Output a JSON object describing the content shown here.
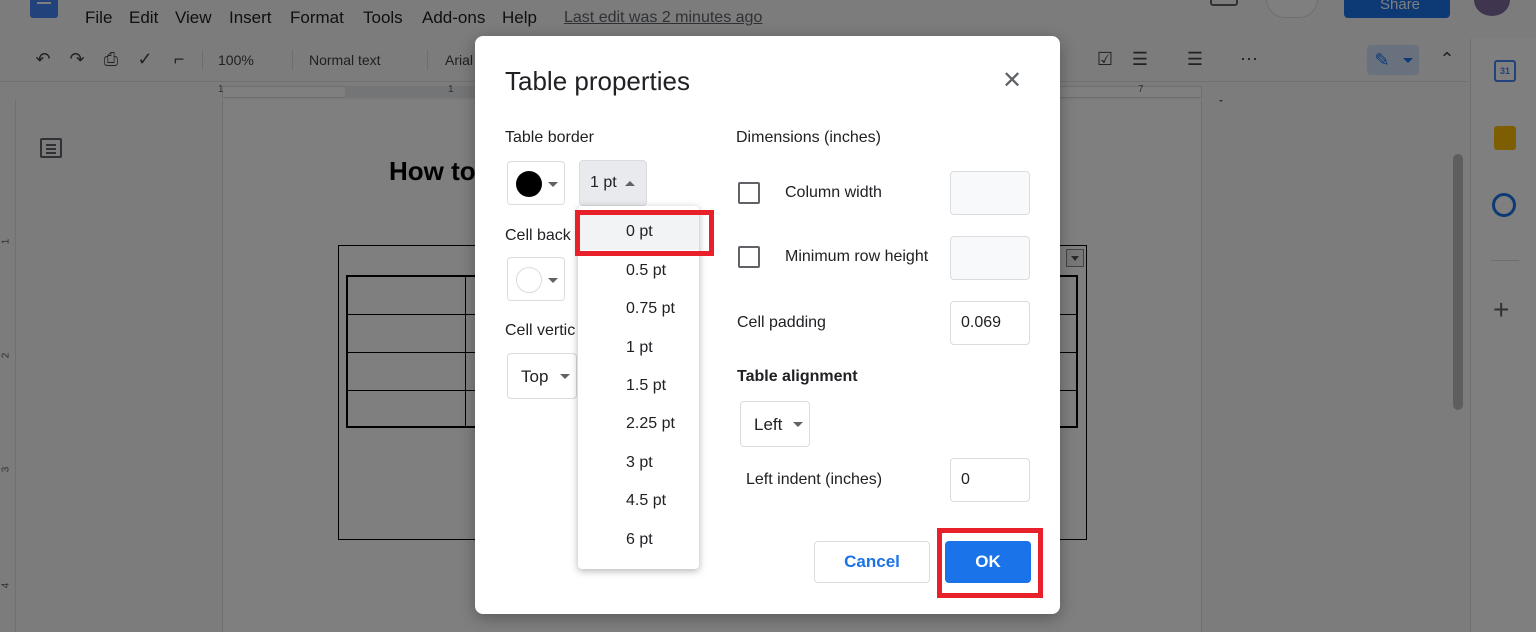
{
  "menubar": {
    "items": [
      "File",
      "Edit",
      "View",
      "Insert",
      "Format",
      "Tools",
      "Add-ons",
      "Help"
    ],
    "last_edit": "Last edit was 2 minutes ago",
    "share_label": "Share"
  },
  "toolbar": {
    "zoom": "100%",
    "style": "Normal text",
    "font": "Arial"
  },
  "ruler": {
    "marks": [
      "1",
      "1",
      "7"
    ]
  },
  "vruler": {
    "marks": [
      "1",
      "2",
      "3",
      "4"
    ]
  },
  "document": {
    "heading": "How to"
  },
  "sidepanel": {
    "calendar_day": "31"
  },
  "dialog": {
    "title": "Table properties",
    "table_border_label": "Table border",
    "border_color": "#000000",
    "border_width": "1 pt",
    "cell_background_label": "Cell back",
    "cell_background_color": "#ffffff",
    "cell_vertical_label": "Cell vertic",
    "cell_vertical_value": "Top",
    "dimensions_label": "Dimensions  (inches)",
    "column_width_label": "Column width",
    "column_width_value": "",
    "min_row_height_label": "Minimum row height",
    "min_row_height_value": "",
    "cell_padding_label": "Cell padding",
    "cell_padding_value": "0.069",
    "table_alignment_label": "Table alignment",
    "table_alignment_value": "Left",
    "left_indent_label": "Left indent  (inches)",
    "left_indent_value": "0",
    "cancel_label": "Cancel",
    "ok_label": "OK"
  },
  "border_dropdown": {
    "options": [
      "0 pt",
      "0.5 pt",
      "0.75 pt",
      "1 pt",
      "1.5 pt",
      "2.25 pt",
      "3 pt",
      "4.5 pt",
      "6 pt"
    ],
    "highlighted": "0 pt"
  },
  "colors": {
    "accent": "#1a73e8",
    "highlight_box": "#e8202a"
  }
}
